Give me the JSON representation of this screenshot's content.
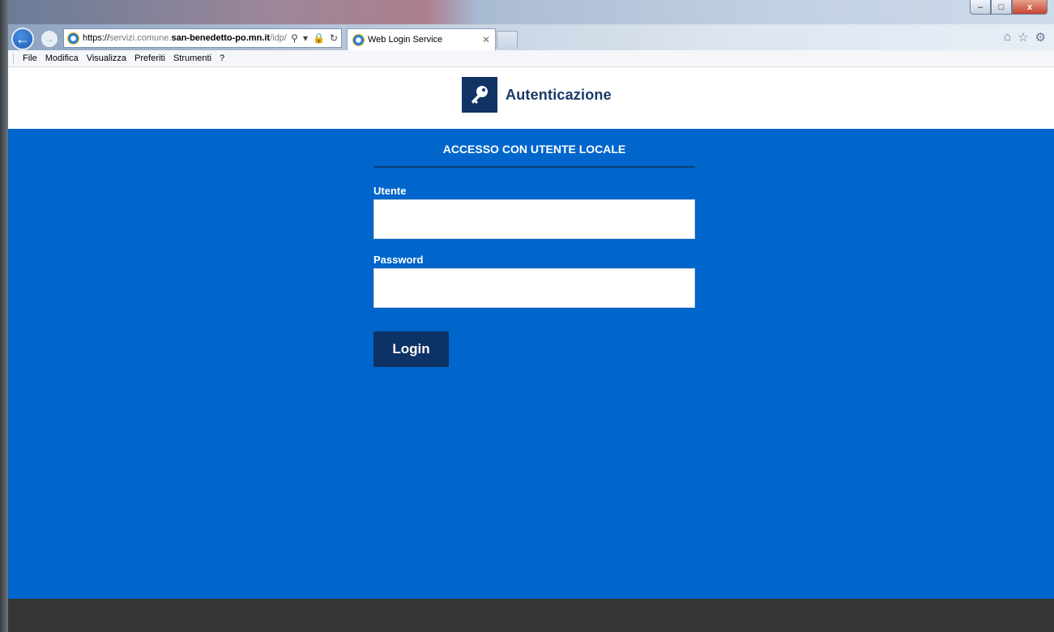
{
  "browser": {
    "url_scheme": "https://",
    "url_domain_light": "servizi.comune.",
    "url_domain_bold": "san-benedetto-po.mn.it",
    "url_path": "/idp/",
    "tab_title": "Web Login Service",
    "window_controls": {
      "minimize": "–",
      "maximize": "□",
      "close": "x"
    },
    "toolbar_icons": [
      "home-icon",
      "star-icon",
      "gear-icon"
    ]
  },
  "menu": {
    "items": [
      "File",
      "Modifica",
      "Visualizza",
      "Preferiti",
      "Strumenti",
      "?"
    ]
  },
  "header": {
    "title": "Autenticazione"
  },
  "form": {
    "title": "ACCESSO CON UTENTE LOCALE",
    "user_label": "Utente",
    "user_value": "",
    "password_label": "Password",
    "password_value": "",
    "login_label": "Login"
  },
  "colors": {
    "main_bg": "#0066cc",
    "logo_bg": "#113464",
    "button_bg": "#0d3366",
    "footer_bg": "#353535"
  }
}
